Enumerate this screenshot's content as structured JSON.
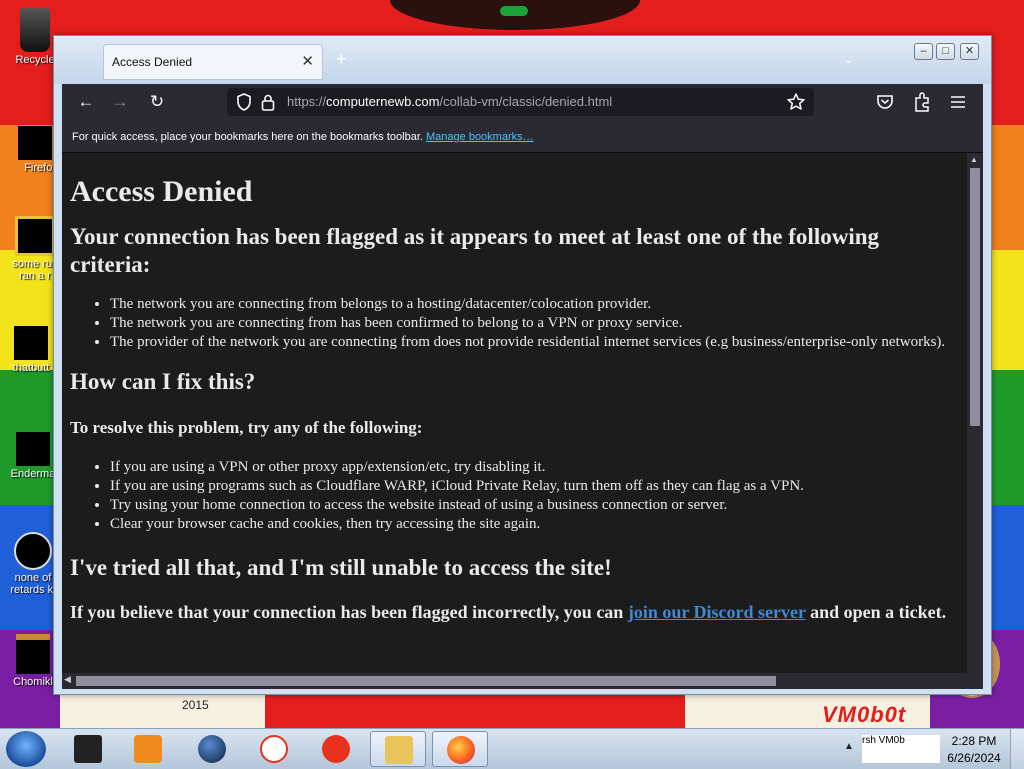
{
  "desktop": {
    "icons": [
      {
        "label": "Recycle"
      },
      {
        "label": "Firefox"
      },
      {
        "label": "some rus"
      },
      {
        "label": "ran a r"
      },
      {
        "label": "thatbutt"
      },
      {
        "label": "Enderma"
      },
      {
        "label": "none of"
      },
      {
        "label": "retards ki"
      },
      {
        "label": "Chomikl"
      }
    ],
    "wallpaper_text": {
      "year": "2015",
      "logo": "VM0b0t"
    }
  },
  "browser": {
    "tab": {
      "title": "Access Denied",
      "close_glyph": "✕"
    },
    "new_tab_glyph": "+",
    "window_buttons": {
      "minimize": "–",
      "maximize": "□",
      "close": "✕"
    },
    "nav": {
      "back": "←",
      "forward": "→",
      "reload": "↻"
    },
    "url": {
      "prefix": "https://",
      "domain": "computernewb.com",
      "path": "/collab-vm/classic/denied.html"
    },
    "bookmarks_bar": {
      "text": "For quick access, place your bookmarks here on the bookmarks toolbar.",
      "link": "Manage bookmarks…"
    }
  },
  "page": {
    "title": "Access Denied",
    "subtitle": "Your connection has been flagged as it appears to meet at least one of the following criteria:",
    "criteria": [
      "The network you are connecting from belongs to a hosting/datacenter/colocation provider.",
      "The network you are connecting from has been confirmed to belong to a VPN or proxy service.",
      "The provider of the network you are connecting from does not provide residential internet services (e.g business/enterprise-only networks)."
    ],
    "fix_heading": "How can I fix this?",
    "fix_intro": "To resolve this problem, try any of the following:",
    "fixes": [
      "If you are using a VPN or other proxy app/extension/etc, try disabling it.",
      "If you are using programs such as Cloudflare WARP, iCloud Private Relay, turn them off as they can flag as a VPN.",
      "Try using your home connection to access the website instead of using a business connection or server.",
      "Clear your browser cache and cookies, then try accessing the site again."
    ],
    "still_heading": "I've tried all that, and I'm still unable to access the site!",
    "contact_before": "If you believe that your connection has been flagged incorrectly, you can ",
    "contact_link": "join our Discord server",
    "contact_after": " and open a ticket."
  },
  "taskbar": {
    "items": [
      {
        "icon": "terminal-icon",
        "color": "#222222"
      },
      {
        "icon": "media-player-icon",
        "color": "#f08a1c"
      },
      {
        "icon": "globe-icon",
        "color": "#1a3a6a"
      },
      {
        "icon": "yandex-browser-icon",
        "color": "#ffffff"
      },
      {
        "icon": "yandex-icon",
        "color": "#e8321c"
      },
      {
        "icon": "file-explorer-icon",
        "color": "#e8c45a"
      },
      {
        "icon": "firefox-icon",
        "color": "#ff7a1a"
      }
    ],
    "tray": {
      "thumb_label": "rsh VM0b",
      "time": "2:28 PM",
      "date": "6/26/2024"
    }
  }
}
